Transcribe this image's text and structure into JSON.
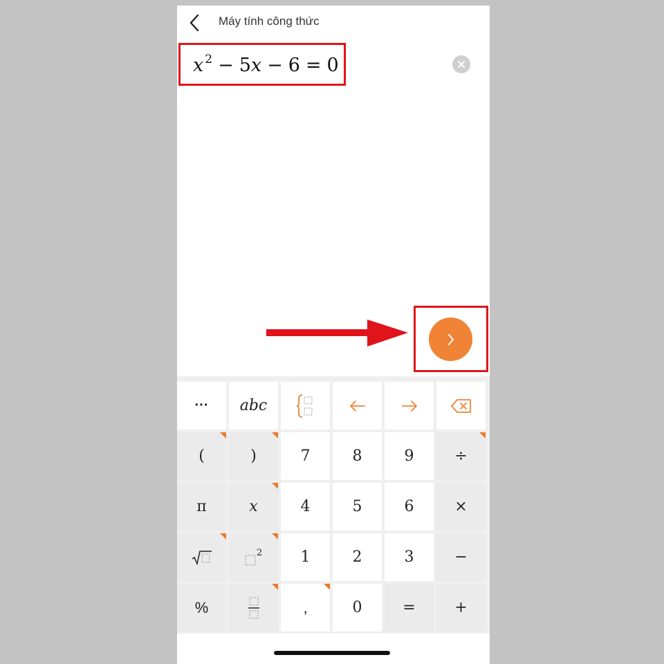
{
  "header": {
    "title": "Máy tính công thức"
  },
  "formula": {
    "var": "x",
    "power": "2",
    "minus1": "−",
    "coef": "5",
    "var2": "x",
    "minus2": "−",
    "const": "6",
    "eq": "=",
    "rhs": "0"
  },
  "toolbar_row": {
    "more": "···",
    "abc": "abc"
  },
  "keys": {
    "paren_open": "(",
    "paren_close": ")",
    "seven": "7",
    "eight": "8",
    "nine": "9",
    "divide": "÷",
    "pi": "π",
    "x": "x",
    "four": "4",
    "five": "5",
    "six": "6",
    "multiply": "×",
    "one": "1",
    "two": "2",
    "three": "3",
    "minus": "−",
    "square_exp": "2",
    "percent": "%",
    "comma": ",",
    "zero": "0",
    "equals": "=",
    "plus": "+"
  },
  "colors": {
    "accent": "#f08335",
    "highlight": "#e0141b"
  }
}
